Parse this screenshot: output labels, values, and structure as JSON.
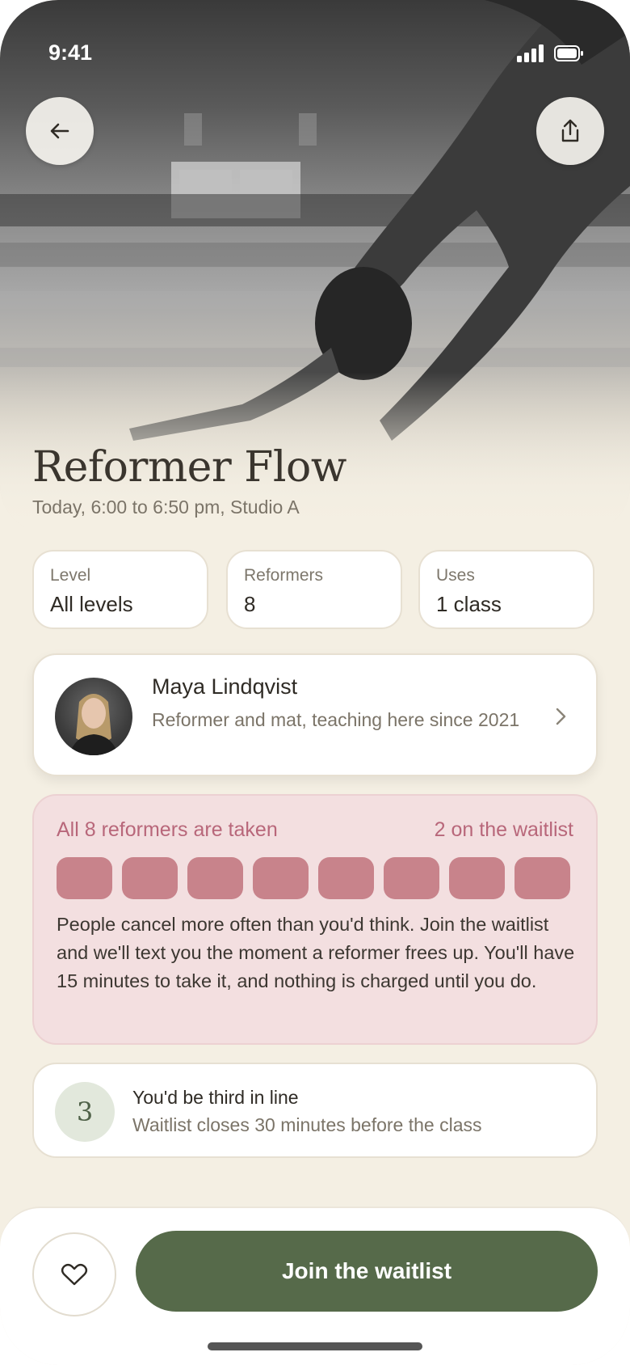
{
  "status_bar": {
    "time": "9:41"
  },
  "hero": {
    "title": "Reformer Flow",
    "subtitle": "Today, 6:00 to 6:50 pm, Studio A"
  },
  "stats": [
    {
      "label": "Level",
      "value": "All levels"
    },
    {
      "label": "Reformers",
      "value": "8"
    },
    {
      "label": "Uses",
      "value": "1 class"
    }
  ],
  "instructor": {
    "name": "Maya Lindqvist",
    "bio": "Reformer and mat, teaching here since 2021"
  },
  "waitlist": {
    "taken_text": "All 8 reformers are taken",
    "count_text": "2 on the waitlist",
    "slots_total": 8,
    "slots_taken": 8,
    "body": "People cancel more often than you'd think. Join the waitlist and we'll text you the moment a reformer frees up. You'll have 15 minutes to take it, and nothing is charged until you do."
  },
  "position": {
    "number": "3",
    "title": "You'd be third in line",
    "subtitle": "Waitlist closes 30 minutes before the class"
  },
  "actions": {
    "join_label": "Join the waitlist"
  },
  "colors": {
    "accent": "#566a4a",
    "background": "#f4efe3",
    "waitlist_bg": "#f3dfe0",
    "waitlist_text": "#b8677a",
    "slot_taken": "#c8838b"
  },
  "icons": {
    "back": "arrow-left-icon",
    "share": "share-icon",
    "chevron": "chevron-right-icon",
    "favorite": "heart-icon"
  }
}
